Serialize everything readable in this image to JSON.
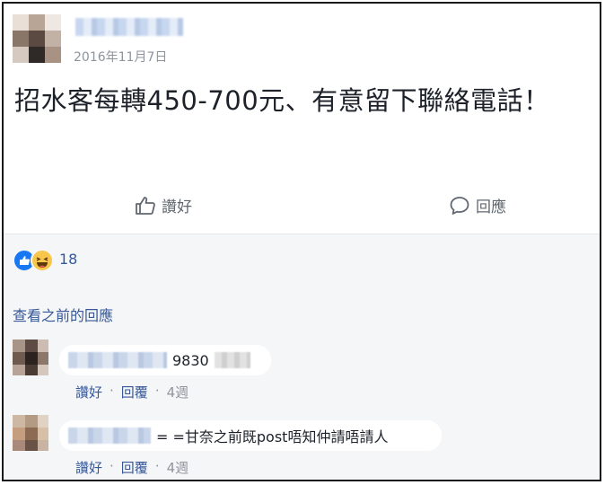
{
  "post": {
    "date": "2016年11月7日",
    "text": "招水客每轉450-700元、有意留下聯絡電話！"
  },
  "actions": {
    "like_label": "讚好",
    "comment_label": "回應"
  },
  "reactions": {
    "count": "18",
    "types": [
      "like-icon",
      "haha-icon"
    ]
  },
  "comments": {
    "view_previous": "查看之前的回應",
    "items": [
      {
        "text": "9830",
        "like_label": "讚好",
        "reply_label": "回覆",
        "time": "4週"
      },
      {
        "text": "= =甘奈之前既post唔知仲請唔請人",
        "like_label": "讚好",
        "reply_label": "回覆",
        "time": "4週"
      }
    ]
  },
  "colors": {
    "link": "#365899",
    "meta": "#8d949e",
    "text": "#1d2129",
    "panel": "#f5f6f7",
    "like_blue": "#1877f2"
  }
}
